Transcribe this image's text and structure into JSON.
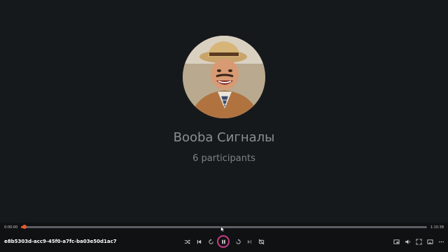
{
  "call": {
    "title": "Booba Сигналы",
    "participants": "6 participants",
    "avatar_icon": "group-avatar-photo"
  },
  "player": {
    "current_time": "0:00:00",
    "total_time": "1:10:38",
    "progress": 0.005,
    "file_name": "e8b5303d-acc9-45f0-a7fc-ba03e50d1ac7",
    "accent_color": "#e85a2a",
    "play_button_color": "#c03d86",
    "state": "playing",
    "buttons": {
      "shuffle": "shuffle-icon",
      "previous": "skip-previous-icon",
      "rewind": "rewind-icon",
      "pause": "pause-icon",
      "forward": "fast-forward-icon",
      "next": "skip-next-icon",
      "repeat": "repeat-off-icon",
      "miniplayer": "miniplayer-icon",
      "volume": "volume-icon",
      "fullscreen": "fullscreen-icon",
      "cast": "cast-icon",
      "more": "more-icon"
    }
  }
}
